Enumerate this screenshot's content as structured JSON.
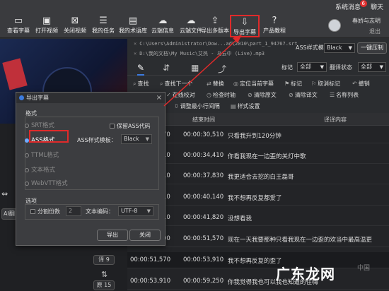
{
  "titlebar": {
    "messages_label": "系统消息",
    "messages_badge": "6",
    "chat_label": "聊天"
  },
  "toolbar": {
    "tools": [
      {
        "icon": "▭",
        "label": "查看字幕"
      },
      {
        "icon": "▣",
        "label": "打开视频"
      },
      {
        "icon": "⊠",
        "label": "关闭视频"
      },
      {
        "icon": "☰",
        "label": "我的任务"
      },
      {
        "icon": "▤",
        "label": "我的术语库"
      },
      {
        "icon": "☁",
        "label": "云端信息"
      },
      {
        "icon": "☁",
        "label": "云端文件"
      },
      {
        "icon": "⇪",
        "label": "导出多版本"
      },
      {
        "icon": "⇩",
        "label": "导出字幕"
      },
      {
        "icon": "?",
        "label": "产品教程"
      }
    ]
  },
  "user": {
    "name": "春娇与志明",
    "logout": "退出"
  },
  "file_paths": [
    "C:\\Users\\Administrator\\Dow...ad\\2010\\part_1_94767.srt",
    "D:\\我的文档\\My Music\\艾热 - 乌云中 (Live).mp3"
  ],
  "ass_template": {
    "label": "ASS样式模板",
    "value": "Black",
    "button": "一键压制"
  },
  "tabs": {
    "mark_label": "标记",
    "mark_value": "全部",
    "status_label": "翻译状态",
    "status_value": "全部"
  },
  "actions": [
    [
      "查找",
      "查找下一个",
      "替换",
      "定位当前字幕",
      "标记",
      "取消标记",
      "撤销"
    ],
    [
      "在线校对",
      "检查时轴",
      "清除原文",
      "清除译文",
      "名称列表"
    ],
    [
      "调整最小行间隔",
      "样式设置"
    ]
  ],
  "table": {
    "headers": {
      "end": "结束时间",
      "content": "译译内容"
    },
    "rows": [
      {
        "start": "70",
        "end": "00:00:30,510",
        "text": "只看我升到120分钟"
      },
      {
        "start": "10",
        "end": "00:00:34,410",
        "text": "你看我现在一边歪的关灯中歌"
      },
      {
        "start": "10",
        "end": "00:00:37,830",
        "text": "我更适合去挖的白王磊哥"
      },
      {
        "start": "10",
        "end": "00:00:40,140",
        "text": "我不想再反复都爱了"
      },
      {
        "start": "10",
        "end": "00:00:41,820",
        "text": "没想看我"
      },
      {
        "start": "00",
        "end": "00:00:51,570",
        "text": "现在一天我要那种只看我现在一边歪的欢当中最高温更"
      },
      {
        "start": "00:00:51,570",
        "end": "00:00:53,910",
        "text": "我不想再反复的歪了"
      },
      {
        "start": "00:00:53,910",
        "end": "00:00:59,250",
        "text": "你我觉得我也可以我也知道的住嗨"
      }
    ]
  },
  "left_pane": {
    "ai_label": "AI翻",
    "time_chip": "0",
    "btn1": "译 9",
    "btn2": "原 15"
  },
  "dialog": {
    "title": "导出字幕",
    "format_section": "格式",
    "formats": [
      "SRT格式",
      "ASS格式",
      "TTML格式",
      "文本格式",
      "WebVTT格式"
    ],
    "selected_format": "ASS格式",
    "keep_ass_code": "保留ASS代码",
    "ass_template_label": "ASS样式模板：",
    "ass_template_value": "Black",
    "options_section": "选项",
    "split_label": "分割份数",
    "split_value": "2",
    "encoding_label": "文本编码：",
    "encoding_value": "UTF-8",
    "export_button": "导出",
    "close_button": "关闭"
  },
  "watermark": {
    "text": "广东龙网",
    "sub": "中国"
  },
  "colors": {
    "highlight": "#e02a2a",
    "accent": "#3c7be0"
  }
}
